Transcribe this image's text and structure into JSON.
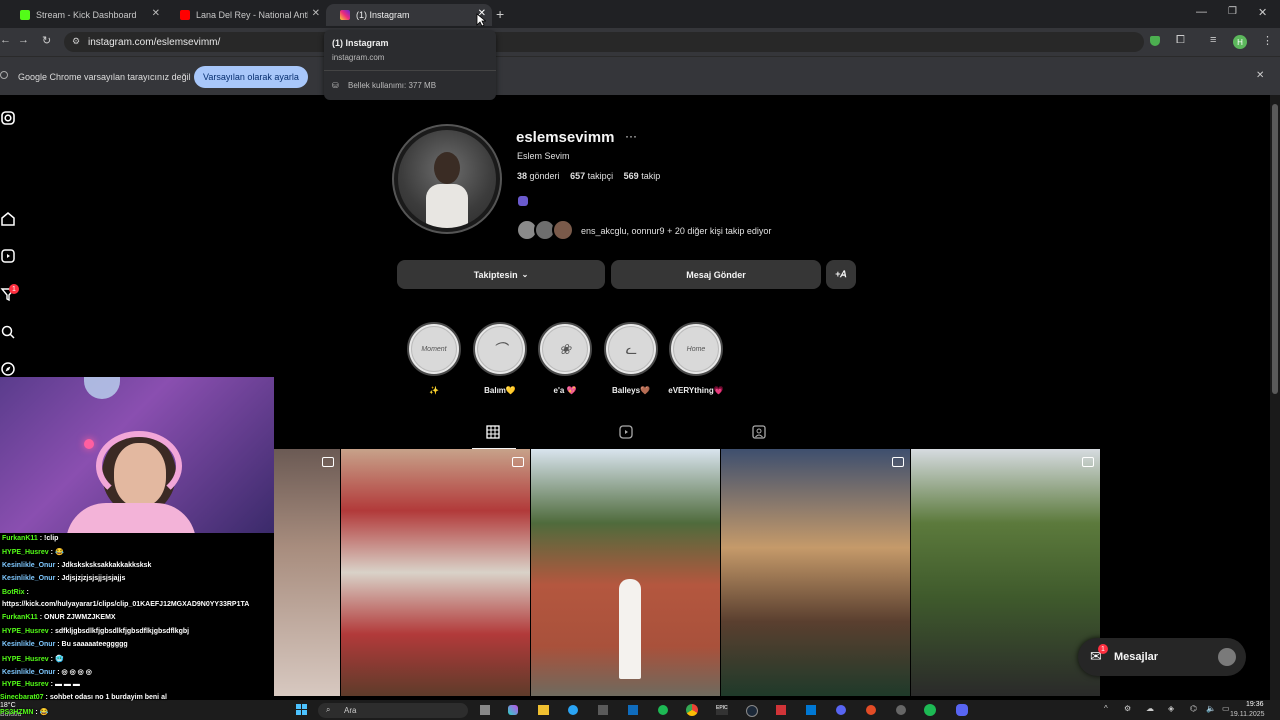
{
  "tabs": [
    {
      "label": "Stream - Kick Dashboard",
      "icon": "kick-icon"
    },
    {
      "label": "Lana Del Rey - National Anthem",
      "icon": "youtube-icon"
    },
    {
      "label": "(1) Instagram",
      "icon": "instagram-icon"
    }
  ],
  "omnibox": {
    "url": "instagram.com/eslemsevimm/"
  },
  "infobar": {
    "message": "Google Chrome varsayılan tarayıcınız değil",
    "button": "Varsayılan olarak ayarla"
  },
  "hovercard": {
    "title": "(1) Instagram",
    "domain": "instagram.com",
    "memory": "Bellek kullanımı: 377 MB"
  },
  "profile": {
    "username": "eslemsevimm",
    "fullname": "Eslem Sevim",
    "posts_count": "38",
    "posts_label": "gönderi",
    "followers_count": "657",
    "followers_label": "takipçi",
    "following_count": "569",
    "following_label": "takip",
    "followed_by": "ens_akcglu, oonnur9 + 20 diğer kişi takip ediyor",
    "follow_button": "Takiptesin",
    "message_button": "Mesaj Gönder"
  },
  "highlights": [
    {
      "label": "✨",
      "inner": "Moment"
    },
    {
      "label": "Balım💛",
      "inner": ""
    },
    {
      "label": "e'a 💖",
      "inner": ""
    },
    {
      "label": "Balleys🤎",
      "inner": ""
    },
    {
      "label": "eVERYthing💗",
      "inner": "Home"
    }
  ],
  "chat": [
    {
      "user": "FurkanK11",
      "msg": "!clip"
    },
    {
      "user": "HYPE_Husrev",
      "msg": "😂"
    },
    {
      "user": "Kesinlikle_Onur",
      "msg": "Jdksksksksakkakkakksksk"
    },
    {
      "user": "Kesinlikle_Onur",
      "msg": "Jdjsjzjzjsjsjjsjsjajjs"
    },
    {
      "user": "BotRix",
      "msg": ""
    },
    {
      "user": "",
      "msg": "https://kick.com/hulyayarar1/clips/clip_01KAEFJ12MGXAD9N0YY33RP1TA"
    },
    {
      "user": "FurkanK11",
      "msg": "ONUR ZJWMZJKEMX"
    },
    {
      "user": "HYPE_Husrev",
      "msg": "sdfkljgbsdlkfjgbsdlkfjgbsdflkjgbsdflkgbj"
    },
    {
      "user": "Kesinlikle_Onur",
      "msg": "Bu saaaaateeggggg"
    },
    {
      "user": "HYPE_Husrev",
      "msg": "🥶"
    },
    {
      "user": "Kesinlikle_Onur",
      "msg": "◎ ◎ ◎ ◎"
    },
    {
      "user": "HYPE_Husrev",
      "msg": "▬ ▬ ▬"
    },
    {
      "user": "Sinecbarat07",
      "msg": "sohbet odası no 1 burdayim beni al"
    },
    {
      "user": "PS3HZMN",
      "msg": "😂"
    }
  ],
  "mesajlar": {
    "label": "Mesajlar",
    "badge": "1"
  },
  "nav_badge": "1",
  "taskbar": {
    "search": "Ara",
    "weather": "18°C",
    "weather_sub": "Bulutlu",
    "time": "19:36",
    "date": "19.11.2025"
  },
  "colors": {
    "chrome_dark": "#202124",
    "chrome_tab": "#35363a",
    "ig_button": "#363636",
    "kick_green": "#53fc18",
    "badge_red": "#ff3040"
  }
}
